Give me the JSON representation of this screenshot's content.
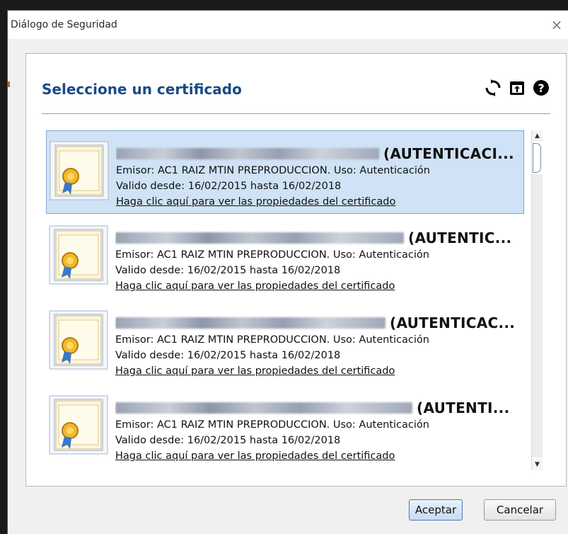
{
  "window": {
    "title": "Diálogo de Seguridad",
    "close_glyph": "×"
  },
  "header": {
    "title": "Seleccione un certificado",
    "icons": [
      "refresh-icon",
      "import-icon",
      "help-icon"
    ]
  },
  "certificates": [
    {
      "selected": true,
      "name_redacted": true,
      "type_label": "(AUTENTICACI...",
      "issuer_line": "Emisor: AC1 RAIZ MTIN PREPRODUCCION. Uso: Autenticación",
      "validity_line": "Valido desde: 16/02/2015 hasta 16/02/2018",
      "link": "Haga clic aquí para ver las propiedades del certificado"
    },
    {
      "selected": false,
      "name_redacted": true,
      "type_label": "(AUTENTIC...",
      "issuer_line": "Emisor: AC1 RAIZ MTIN PREPRODUCCION. Uso: Autenticación",
      "validity_line": "Valido desde: 16/02/2015 hasta 16/02/2018",
      "link": "Haga clic aquí para ver las propiedades del certificado"
    },
    {
      "selected": false,
      "name_redacted": true,
      "type_label": "(AUTENTICAC...",
      "issuer_line": "Emisor: AC1 RAIZ MTIN PREPRODUCCION. Uso: Autenticación",
      "validity_line": "Valido desde: 16/02/2015 hasta 16/02/2018",
      "link": "Haga clic aquí para ver las propiedades del certificado"
    },
    {
      "selected": false,
      "name_redacted": true,
      "type_label": "(AUTENTI...",
      "issuer_line": "Emisor: AC1 RAIZ MTIN PREPRODUCCION. Uso: Autenticación",
      "validity_line": "Valido desde: 16/02/2015 hasta 16/02/2018",
      "link": "Haga clic aquí para ver las propiedades del certificado"
    }
  ],
  "buttons": {
    "accept": "Aceptar",
    "cancel": "Cancelar"
  },
  "colors": {
    "header_title": "#1a4a86",
    "selected_bg": "#cfe2f6",
    "selected_border": "#7ea7d4",
    "accept_border": "#4a7ab8"
  }
}
